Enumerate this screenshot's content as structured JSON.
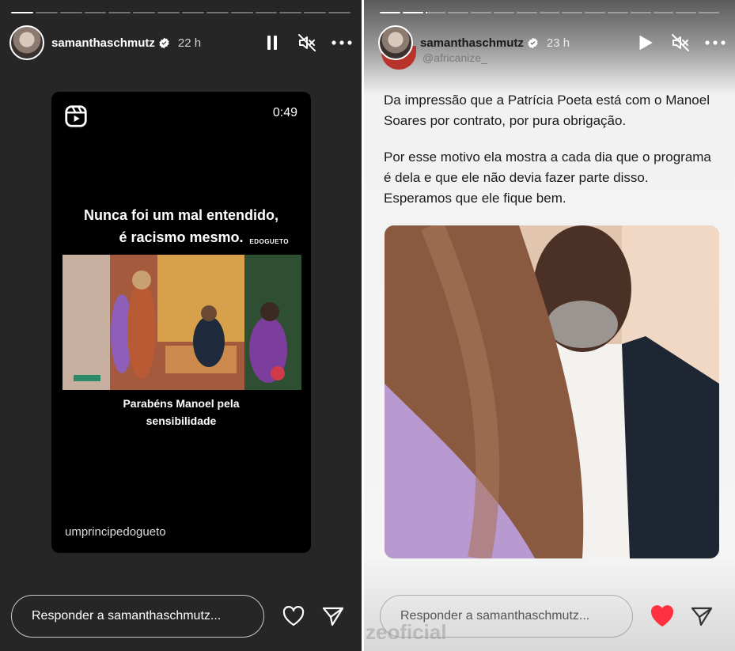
{
  "left": {
    "progress": [
      1,
      0,
      0,
      0,
      0,
      0,
      0,
      0,
      0,
      0,
      0,
      0,
      0,
      0
    ],
    "username": "samanthaschmutz",
    "time": "22 h",
    "reel": {
      "duration": "0:49",
      "caption_line1": "Nunca foi um mal entendido,",
      "caption_line2": "é racismo mesmo.",
      "tag": "EDOGUETO",
      "sub_line1": "Parabéns Manoel pela",
      "sub_line2": "sensibilidade",
      "account": "umprincipedogueto"
    },
    "reply_placeholder": "Responder a samanthaschmutz...",
    "liked": false
  },
  "right": {
    "progress": [
      1,
      1,
      0.1,
      0,
      0,
      0,
      0,
      0,
      0,
      0,
      0,
      0,
      0,
      0,
      0
    ],
    "username": "samanthaschmutz",
    "time": "23 h",
    "tweet": {
      "handle": "@africanize_",
      "paragraph1": "Da impressão que a Patrícia Poeta está com o Manoel Soares por contrato, por pura obrigação.",
      "paragraph2": "Por esse motivo ela mostra a cada dia que o programa é dela e que ele não devia fazer parte disso. Esperamos que ele fique bem."
    },
    "reply_placeholder": "Responder a samanthaschmutz...",
    "liked": true,
    "watermark": "zeoficial"
  },
  "colors": {
    "heart_red": "#ff3040",
    "dark_bg": "#262626"
  }
}
